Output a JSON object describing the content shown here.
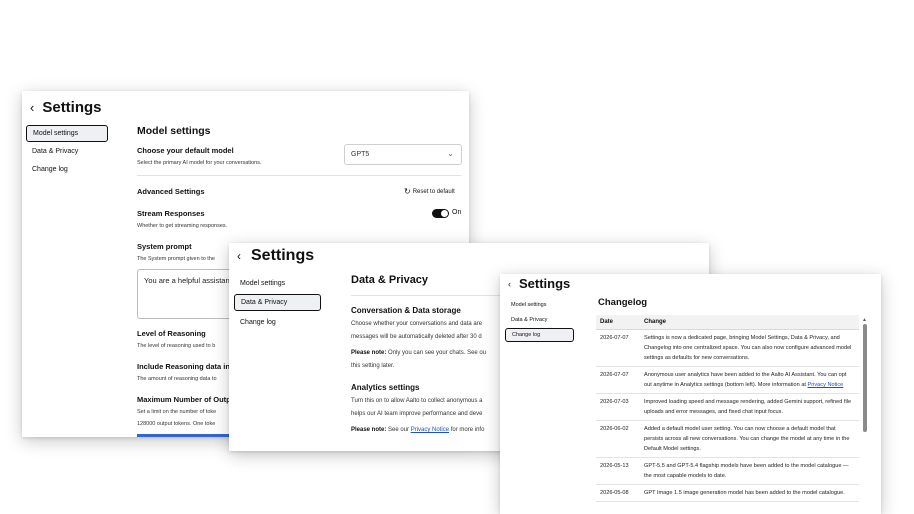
{
  "nav": [
    "Model settings",
    "Data & Privacy",
    "Change log"
  ],
  "back_glyph": "‹",
  "panel1": {
    "title": "Settings",
    "heading": "Model settings",
    "default_model": {
      "label": "Choose your default model",
      "sub": "Select the primary AI model for your conversations.",
      "value": "GPT5"
    },
    "advanced_label": "Advanced Settings",
    "reset_label": "Reset to default",
    "stream": {
      "label": "Stream Responses",
      "sub": "Whether to get streaming responses.",
      "state": "On"
    },
    "system_prompt": {
      "label": "System prompt",
      "sub": "The System prompt given to the",
      "value": "You are a helpful assistan"
    },
    "reasoning": {
      "label": "Level of Reasoning",
      "sub": "The level of reasoning used to b"
    },
    "include_reasoning": {
      "label": "Include Reasoning data in",
      "sub": "The amount of reasoning data to"
    },
    "max_output": {
      "label": "Maximum Number of Outp",
      "sub1": "Set a limit on the number of toke",
      "sub2": "128000 output tokens. One toke"
    }
  },
  "panel2": {
    "title": "Settings",
    "heading": "Data & Privacy",
    "storage": {
      "label": "Conversation & Data storage",
      "line1": "Choose whether your conversations and data are",
      "line2": "messages will be automatically deleted after 30 d",
      "note_label": "Please note:",
      "note_text": " Only you can see your chats. See ou",
      "line3": "this setting later."
    },
    "analytics": {
      "label": "Analytics settings",
      "line1": "Turn this on to allow Aalto to collect anonymous a",
      "line2": "helps our AI team improve performance and deve",
      "note_label": "Please note:",
      "note_pre": " See our ",
      "note_link": "Privacy Notice",
      "note_post": " for more info"
    }
  },
  "panel3": {
    "title": "Settings",
    "heading": "Changelog",
    "columns": [
      "Date",
      "Change"
    ],
    "rows": [
      {
        "date": "2026-07-07",
        "text": "Settings is now a dedicated page, bringing Model Settings, Data & Privacy, and Changelog into one centralized space. You can also now configure advanced model settings as defaults for new conversations."
      },
      {
        "date": "2026-07-07",
        "text": "Anonymous user analytics have been added to the Aalto AI Assistant. You can opt out anytime in Analytics settings (bottom left). More information at ",
        "link": "Privacy Notice"
      },
      {
        "date": "2026-07-03",
        "text": "Improved loading speed and message rendering, added Gemini support, refined file uploads and error messages, and fixed chat input focus."
      },
      {
        "date": "2026-06-02",
        "text": "Added a default model user setting. You can now choose a default model that persists across all new conversations. You can change the model at any time in the Default Model settings."
      },
      {
        "date": "2026-05-13",
        "text": "GPT-5.5 and GPT-5.4 flagship models have been added to the model catalogue — the most capable models to date."
      },
      {
        "date": "2026-05-08",
        "text": "GPT Image 1.5 image generation model has been added to the model catalogue."
      }
    ]
  }
}
